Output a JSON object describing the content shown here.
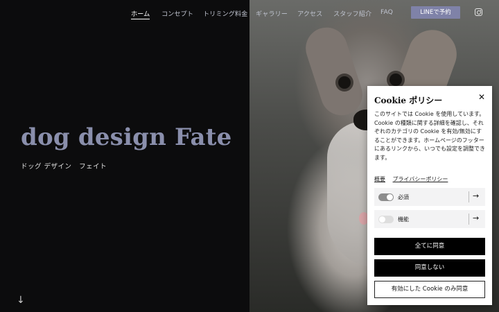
{
  "nav": {
    "items": [
      {
        "label": "ホーム",
        "active": true
      },
      {
        "label": "コンセプト",
        "active": false
      },
      {
        "label": "トリミング料金",
        "active": false
      },
      {
        "label": "ギャラリー",
        "active": false
      },
      {
        "label": "アクセス",
        "active": false
      },
      {
        "label": "スタッフ紹介",
        "active": false
      },
      {
        "label": "FAQ",
        "active": false
      }
    ],
    "line_button": "LINEで予約",
    "instagram_icon": "instagram-icon"
  },
  "hero": {
    "title": "dog design Fate",
    "subtitle": "ドッグ デザイン   フェイト",
    "scroll_icon": "down-arrow-icon"
  },
  "cookie": {
    "title": "Cookie ポリシー",
    "close_icon": "close-icon",
    "body": "このサイトでは Cookie を使用しています。Cookie の種類に関する詳細を確認し、それぞれのカテゴリの Cookie を有効/無効にすることができます。ホームページのフッターにあるリンクから、いつでも設定を調整できます。",
    "links": [
      "概要",
      "プライバシーポリシー"
    ],
    "toggles": [
      {
        "label": "必須",
        "enabled": true
      },
      {
        "label": "機能",
        "enabled": false
      }
    ],
    "buttons": {
      "accept_all": "全てに同意",
      "decline": "同意しない",
      "accept_selected": "有効にした Cookie のみ同意"
    }
  },
  "colors": {
    "background": "#0c0c0d",
    "accent": "#7f82a8",
    "hero_title": "#8a8fac"
  }
}
